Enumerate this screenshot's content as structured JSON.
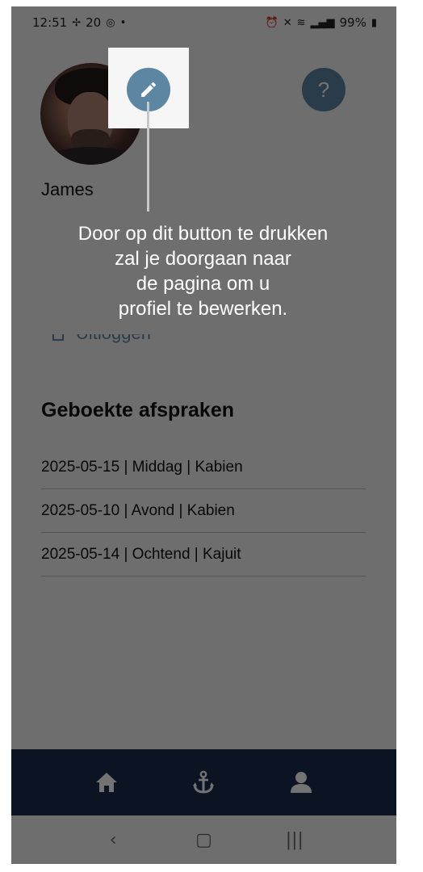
{
  "status_bar": {
    "time": "12:51",
    "notif_count": "20",
    "battery": "99%"
  },
  "profile": {
    "name": "James"
  },
  "logout": {
    "label": "Uitloggen"
  },
  "appointments": {
    "title": "Geboekte afspraken",
    "items": [
      "2025-05-15 | Middag | Kabien",
      "2025-05-10 | Avond | Kabien",
      "2025-05-14 | Ochtend | Kajuit"
    ]
  },
  "tooltip": {
    "lines": [
      "Door op dit button te drukken",
      "zal je doorgaan naar",
      "de pagina om u",
      "profiel te bewerken."
    ]
  },
  "help": {
    "symbol": "?"
  },
  "bottom_nav": {
    "items": [
      "home-icon",
      "anchor-icon",
      "person-icon"
    ]
  },
  "android_nav": {
    "back": "‹",
    "home": "▢",
    "recents": "|||"
  },
  "colors": {
    "accent": "#5d86a2",
    "nav_bg": "#1b2c4e"
  }
}
